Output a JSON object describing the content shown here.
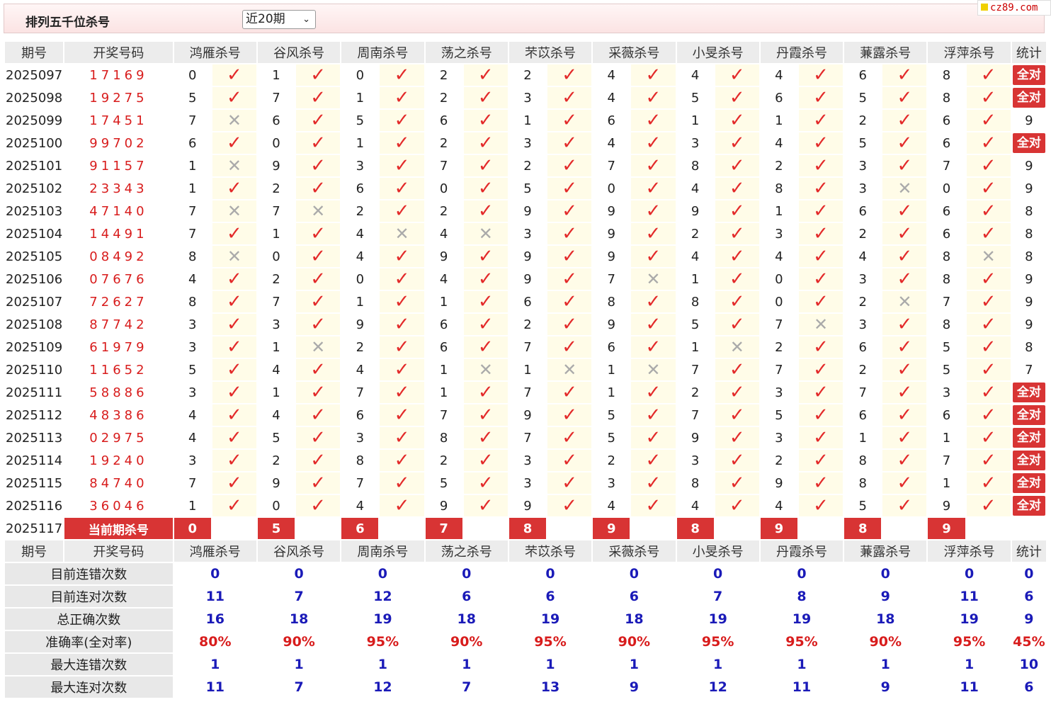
{
  "header": {
    "title": "排列五千位杀号",
    "period_select": "近20期",
    "logo_text": "cz89.com"
  },
  "columns": {
    "period": "期号",
    "numbers": "开奖号码",
    "experts": [
      "鸿雁杀号",
      "谷风杀号",
      "周南杀号",
      "荡之杀号",
      "芣苡杀号",
      "采薇杀号",
      "小旻杀号",
      "丹霞杀号",
      "蒹露杀号",
      "浮萍杀号"
    ],
    "stat": "统计"
  },
  "marks": {
    "right": "✓",
    "wrong": "✕",
    "all_right": "全对"
  },
  "rows": [
    {
      "period": "2025097",
      "numbers": "17169",
      "kills": [
        0,
        1,
        0,
        2,
        2,
        4,
        4,
        4,
        6,
        8
      ],
      "ok": [
        1,
        1,
        1,
        1,
        1,
        1,
        1,
        1,
        1,
        1
      ],
      "stat": "全对"
    },
    {
      "period": "2025098",
      "numbers": "19275",
      "kills": [
        5,
        7,
        1,
        2,
        3,
        4,
        5,
        6,
        5,
        8
      ],
      "ok": [
        1,
        1,
        1,
        1,
        1,
        1,
        1,
        1,
        1,
        1
      ],
      "stat": "全对"
    },
    {
      "period": "2025099",
      "numbers": "17451",
      "kills": [
        7,
        6,
        5,
        6,
        1,
        6,
        1,
        1,
        2,
        6
      ],
      "ok": [
        0,
        1,
        1,
        1,
        1,
        1,
        1,
        1,
        1,
        1
      ],
      "stat": "9"
    },
    {
      "period": "2025100",
      "numbers": "99702",
      "kills": [
        6,
        0,
        1,
        2,
        3,
        4,
        3,
        4,
        5,
        6
      ],
      "ok": [
        1,
        1,
        1,
        1,
        1,
        1,
        1,
        1,
        1,
        1
      ],
      "stat": "全对"
    },
    {
      "period": "2025101",
      "numbers": "91157",
      "kills": [
        1,
        9,
        3,
        7,
        2,
        7,
        8,
        2,
        3,
        7
      ],
      "ok": [
        0,
        1,
        1,
        1,
        1,
        1,
        1,
        1,
        1,
        1
      ],
      "stat": "9"
    },
    {
      "period": "2025102",
      "numbers": "23343",
      "kills": [
        1,
        2,
        6,
        0,
        5,
        0,
        4,
        8,
        3,
        0
      ],
      "ok": [
        1,
        1,
        1,
        1,
        1,
        1,
        1,
        1,
        0,
        1
      ],
      "stat": "9"
    },
    {
      "period": "2025103",
      "numbers": "47140",
      "kills": [
        7,
        7,
        2,
        2,
        9,
        9,
        9,
        1,
        6,
        6
      ],
      "ok": [
        0,
        0,
        1,
        1,
        1,
        1,
        1,
        1,
        1,
        1
      ],
      "stat": "8"
    },
    {
      "period": "2025104",
      "numbers": "14491",
      "kills": [
        7,
        1,
        4,
        4,
        3,
        9,
        2,
        3,
        2,
        6
      ],
      "ok": [
        1,
        1,
        0,
        0,
        1,
        1,
        1,
        1,
        1,
        1
      ],
      "stat": "8"
    },
    {
      "period": "2025105",
      "numbers": "08492",
      "kills": [
        8,
        0,
        4,
        9,
        9,
        9,
        4,
        4,
        4,
        8
      ],
      "ok": [
        0,
        1,
        1,
        1,
        1,
        1,
        1,
        1,
        1,
        0
      ],
      "stat": "8"
    },
    {
      "period": "2025106",
      "numbers": "07676",
      "kills": [
        4,
        2,
        0,
        4,
        9,
        7,
        1,
        0,
        3,
        8
      ],
      "ok": [
        1,
        1,
        1,
        1,
        1,
        0,
        1,
        1,
        1,
        1
      ],
      "stat": "9"
    },
    {
      "period": "2025107",
      "numbers": "72627",
      "kills": [
        8,
        7,
        1,
        1,
        6,
        8,
        8,
        0,
        2,
        7
      ],
      "ok": [
        1,
        1,
        1,
        1,
        1,
        1,
        1,
        1,
        0,
        1
      ],
      "stat": "9"
    },
    {
      "period": "2025108",
      "numbers": "87742",
      "kills": [
        3,
        3,
        9,
        6,
        2,
        9,
        5,
        7,
        3,
        8
      ],
      "ok": [
        1,
        1,
        1,
        1,
        1,
        1,
        1,
        0,
        1,
        1
      ],
      "stat": "9"
    },
    {
      "period": "2025109",
      "numbers": "61979",
      "kills": [
        3,
        1,
        2,
        6,
        7,
        6,
        1,
        2,
        6,
        5
      ],
      "ok": [
        1,
        0,
        1,
        1,
        1,
        1,
        0,
        1,
        1,
        1
      ],
      "stat": "8"
    },
    {
      "period": "2025110",
      "numbers": "11652",
      "kills": [
        5,
        4,
        4,
        1,
        1,
        1,
        7,
        7,
        2,
        5
      ],
      "ok": [
        1,
        1,
        1,
        0,
        0,
        0,
        1,
        1,
        1,
        1
      ],
      "stat": "7"
    },
    {
      "period": "2025111",
      "numbers": "58886",
      "kills": [
        3,
        1,
        7,
        1,
        7,
        1,
        2,
        3,
        7,
        3
      ],
      "ok": [
        1,
        1,
        1,
        1,
        1,
        1,
        1,
        1,
        1,
        1
      ],
      "stat": "全对"
    },
    {
      "period": "2025112",
      "numbers": "48386",
      "kills": [
        4,
        4,
        6,
        7,
        9,
        5,
        7,
        5,
        6,
        6
      ],
      "ok": [
        1,
        1,
        1,
        1,
        1,
        1,
        1,
        1,
        1,
        1
      ],
      "stat": "全对"
    },
    {
      "period": "2025113",
      "numbers": "02975",
      "kills": [
        4,
        5,
        3,
        8,
        7,
        5,
        9,
        3,
        1,
        1
      ],
      "ok": [
        1,
        1,
        1,
        1,
        1,
        1,
        1,
        1,
        1,
        1
      ],
      "stat": "全对"
    },
    {
      "period": "2025114",
      "numbers": "19240",
      "kills": [
        3,
        2,
        8,
        2,
        3,
        2,
        3,
        2,
        8,
        7
      ],
      "ok": [
        1,
        1,
        1,
        1,
        1,
        1,
        1,
        1,
        1,
        1
      ],
      "stat": "全对"
    },
    {
      "period": "2025115",
      "numbers": "84740",
      "kills": [
        7,
        9,
        7,
        5,
        3,
        3,
        8,
        9,
        8,
        1
      ],
      "ok": [
        1,
        1,
        1,
        1,
        1,
        1,
        1,
        1,
        1,
        1
      ],
      "stat": "全对"
    },
    {
      "period": "2025116",
      "numbers": "36046",
      "kills": [
        1,
        0,
        4,
        9,
        9,
        4,
        4,
        4,
        5,
        9
      ],
      "ok": [
        1,
        1,
        1,
        1,
        1,
        1,
        1,
        1,
        1,
        1
      ],
      "stat": "全对"
    }
  ],
  "current": {
    "period": "2025117",
    "label": "当前期杀号",
    "kills": [
      "0",
      "5",
      "6",
      "7",
      "8",
      "9",
      "8",
      "9",
      "8",
      "9"
    ]
  },
  "summary": [
    {
      "label": "目前连错次数",
      "values": [
        "0",
        "0",
        "0",
        "0",
        "0",
        "0",
        "0",
        "0",
        "0",
        "0"
      ],
      "stat": "0",
      "type": "count"
    },
    {
      "label": "目前连对次数",
      "values": [
        "11",
        "7",
        "12",
        "6",
        "6",
        "6",
        "7",
        "8",
        "9",
        "11"
      ],
      "stat": "6",
      "type": "count"
    },
    {
      "label": "总正确次数",
      "values": [
        "16",
        "18",
        "19",
        "18",
        "19",
        "18",
        "19",
        "19",
        "18",
        "19"
      ],
      "stat": "9",
      "type": "count"
    },
    {
      "label": "准确率(全对率)",
      "values": [
        "80%",
        "90%",
        "95%",
        "90%",
        "95%",
        "90%",
        "95%",
        "95%",
        "90%",
        "95%"
      ],
      "stat": "45%",
      "type": "rate"
    },
    {
      "label": "最大连错次数",
      "values": [
        "1",
        "1",
        "1",
        "1",
        "1",
        "1",
        "1",
        "1",
        "1",
        "1"
      ],
      "stat": "10",
      "type": "count"
    },
    {
      "label": "最大连对次数",
      "values": [
        "11",
        "7",
        "12",
        "7",
        "13",
        "9",
        "12",
        "11",
        "9",
        "11"
      ],
      "stat": "6",
      "type": "count"
    }
  ]
}
